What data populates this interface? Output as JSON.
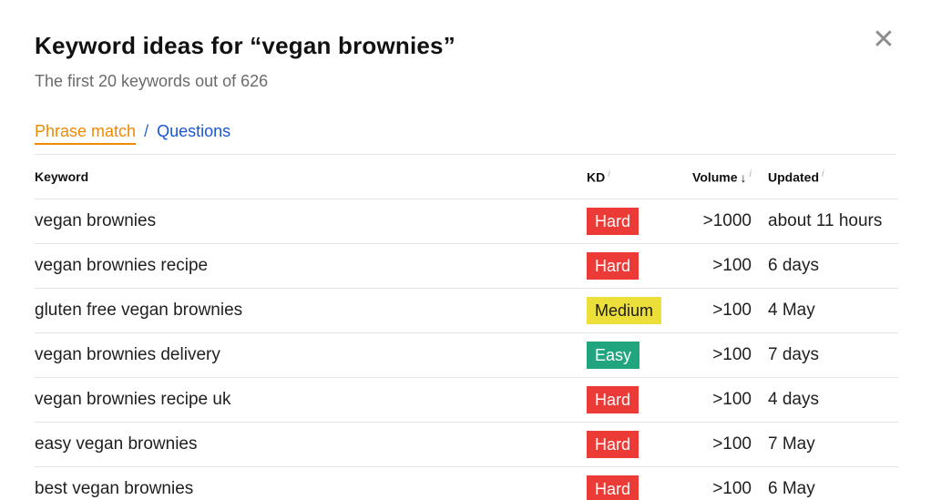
{
  "modal": {
    "title": "Keyword ideas for “vegan brownies”",
    "subtitle": "The first 20 keywords out of 626",
    "close_icon": "close-icon"
  },
  "tabs": {
    "active": "Phrase match",
    "separator": "/",
    "other": "Questions"
  },
  "colors": {
    "hard": "#ec3a36",
    "medium": "#ecdf3a",
    "easy": "#20a57f",
    "active_tab": "#f08a00",
    "link": "#1a55d6"
  },
  "table": {
    "headers": {
      "keyword": "Keyword",
      "kd": "KD",
      "volume": "Volume",
      "updated": "Updated",
      "info_glyph": "i",
      "sort_arrow": "↓"
    },
    "rows": [
      {
        "keyword": "vegan brownies",
        "kd": "Hard",
        "kd_level": "hard",
        "volume": ">1000",
        "updated": "about 11 hours"
      },
      {
        "keyword": "vegan brownies recipe",
        "kd": "Hard",
        "kd_level": "hard",
        "volume": ">100",
        "updated": "6 days"
      },
      {
        "keyword": "gluten free vegan brownies",
        "kd": "Medium",
        "kd_level": "medium",
        "volume": ">100",
        "updated": "4 May"
      },
      {
        "keyword": "vegan brownies delivery",
        "kd": "Easy",
        "kd_level": "easy",
        "volume": ">100",
        "updated": "7 days"
      },
      {
        "keyword": "vegan brownies recipe uk",
        "kd": "Hard",
        "kd_level": "hard",
        "volume": ">100",
        "updated": "4 days"
      },
      {
        "keyword": "easy vegan brownies",
        "kd": "Hard",
        "kd_level": "hard",
        "volume": ">100",
        "updated": "7 May"
      },
      {
        "keyword": "best vegan brownies",
        "kd": "Hard",
        "kd_level": "hard",
        "volume": ">100",
        "updated": "6 May"
      }
    ]
  }
}
